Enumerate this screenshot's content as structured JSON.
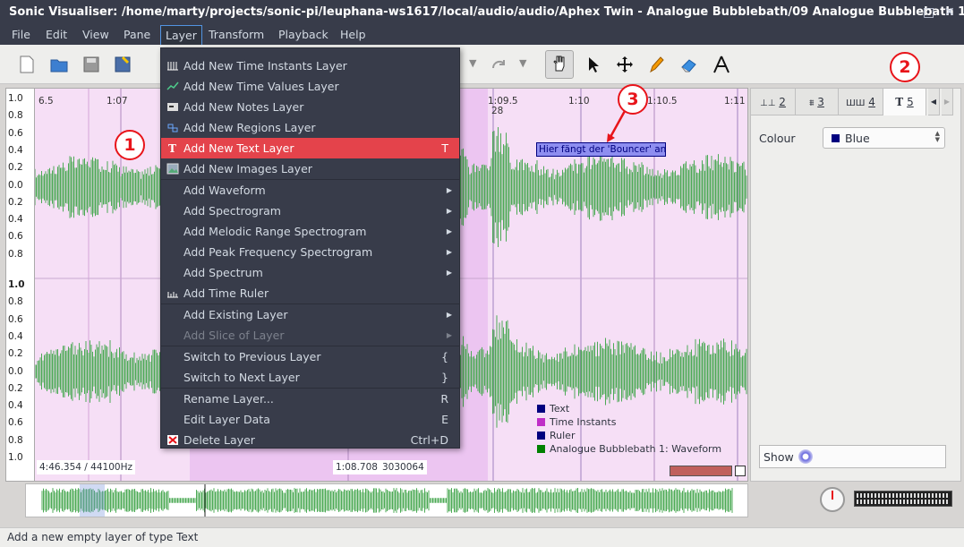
{
  "window": {
    "title": "Sonic Visualiser: /home/marty/projects/sonic-pi/leuphana-ws1617/local/audio/audio/Aphex Twin - Analogue Bubblebath/09 Analogue Bubblebath 1....",
    "minimize": "–",
    "maximize": "□",
    "close": "✕"
  },
  "menubar": [
    "File",
    "Edit",
    "View",
    "Pane",
    "Layer",
    "Transform",
    "Playback",
    "Help"
  ],
  "layer_menu": {
    "items": [
      {
        "label": "Add New Time Instants Layer",
        "icon": "time-instants-icon"
      },
      {
        "label": "Add New Time Values Layer",
        "icon": "time-values-icon"
      },
      {
        "label": "Add New Notes Layer",
        "icon": "notes-icon"
      },
      {
        "label": "Add New Regions Layer",
        "icon": "regions-icon"
      },
      {
        "label": "Add New Text Layer",
        "icon": "text-icon",
        "shortcut": "T",
        "highlighted": true
      },
      {
        "label": "Add New Images Layer",
        "icon": "images-icon"
      },
      {
        "label": "Add Waveform",
        "submenu": true
      },
      {
        "label": "Add Spectrogram",
        "submenu": true
      },
      {
        "label": "Add Melodic Range Spectrogram",
        "submenu": true
      },
      {
        "label": "Add Peak Frequency Spectrogram",
        "submenu": true
      },
      {
        "label": "Add Spectrum",
        "submenu": true
      },
      {
        "label": "Add Time Ruler",
        "icon": "time-ruler-icon"
      },
      {
        "label": "Add Existing Layer",
        "submenu": true
      },
      {
        "label": "Add Slice of Layer",
        "submenu": true,
        "disabled": true
      },
      {
        "label": "Switch to Previous Layer",
        "shortcut": "{"
      },
      {
        "label": "Switch to Next Layer",
        "shortcut": "}"
      },
      {
        "label": "Rename Layer...",
        "shortcut": "R"
      },
      {
        "label": "Edit Layer Data",
        "shortcut": "E"
      },
      {
        "label": "Delete Layer",
        "shortcut": "Ctrl+D",
        "icon": "delete-icon"
      }
    ]
  },
  "pane": {
    "ruler_labels": [
      "6.5",
      "1:07",
      "1:09.5",
      "1:10",
      "1:10.5",
      "1:11"
    ],
    "bar_number": "28",
    "y_ticks_top": [
      "1.0",
      "0.8",
      "0.6",
      "0.4",
      "0.2",
      "0.0",
      "0.2",
      "0.4",
      "0.6",
      "0.8"
    ],
    "y_ticks_bottom": [
      "1.0",
      "0.8",
      "0.6",
      "0.4",
      "0.2",
      "0.0",
      "0.2",
      "0.4",
      "0.6",
      "0.8",
      "1.0"
    ],
    "text_annotation": "Hier fängt der 'Bouncer' an",
    "legend": [
      {
        "label": "Text",
        "color": "#00007f"
      },
      {
        "label": "Time Instants",
        "color": "#bf2ec7"
      },
      {
        "label": "Ruler",
        "color": "#00007f"
      },
      {
        "label": "Analogue Bubblebath 1: Waveform",
        "color": "#008000"
      }
    ],
    "duration_readout": "4:46.354 / 44100Hz",
    "cursor_time": "1:08.708",
    "cursor_frame": "3030064"
  },
  "properties": {
    "tabs": [
      "2",
      "3",
      "4",
      "5"
    ],
    "tab_icons": [
      "ruler-icon",
      "waveform-icon",
      "instants-icon",
      "text-icon"
    ],
    "selected_tab": "5",
    "colour_label": "Colour",
    "colour_value": "Blue",
    "show_label": "Show"
  },
  "callouts": [
    "1",
    "2",
    "3"
  ],
  "status": "Add a new empty layer of type Text",
  "colors": {
    "waveform": "#4caa55",
    "pane_bg": "#f6dff6",
    "highlight": "#e4434b",
    "menu_bg": "#383c4a"
  }
}
